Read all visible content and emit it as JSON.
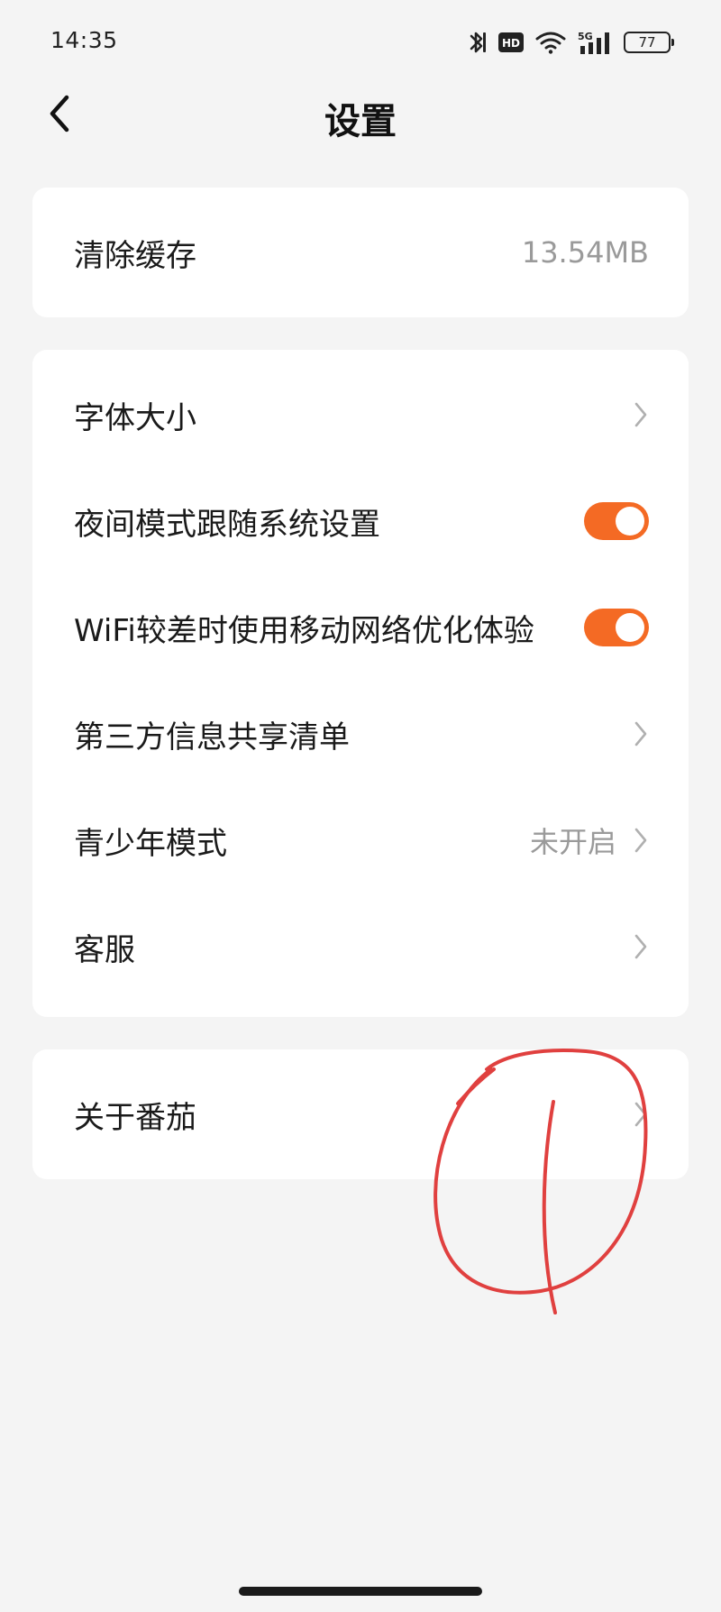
{
  "status_bar": {
    "time": "14:35",
    "hd_label": "HD",
    "network_label": "5G",
    "battery_level": "77"
  },
  "nav": {
    "title": "设置"
  },
  "colors": {
    "accent": "#f46a24",
    "annotation": "#e0403f"
  },
  "cards": [
    {
      "items": [
        {
          "label": "清除缓存",
          "value": "13.54MB",
          "control": "value"
        }
      ]
    },
    {
      "items": [
        {
          "label": "字体大小",
          "control": "chevron"
        },
        {
          "label": "夜间模式跟随系统设置",
          "control": "toggle",
          "on": true
        },
        {
          "label": "WiFi较差时使用移动网络优化体验",
          "control": "toggle",
          "on": true
        },
        {
          "label": "第三方信息共享清单",
          "control": "chevron"
        },
        {
          "label": "青少年模式",
          "value": "未开启",
          "control": "chevron"
        },
        {
          "label": "客服",
          "control": "chevron"
        }
      ]
    },
    {
      "items": [
        {
          "label": "关于番茄",
          "control": "chevron"
        }
      ]
    }
  ]
}
